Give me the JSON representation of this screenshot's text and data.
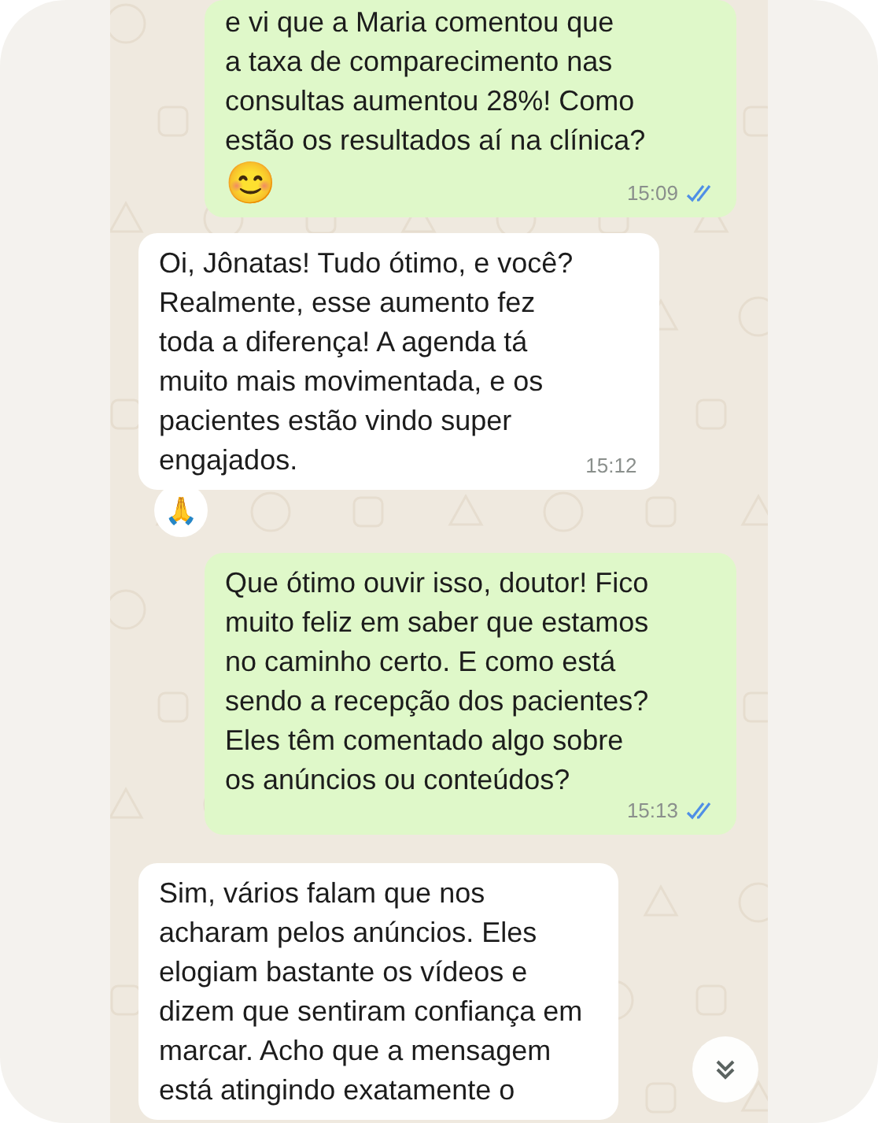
{
  "messages": [
    {
      "kind": "sent",
      "text": "e vi que a Maria comentou que\na taxa de comparecimento nas\nconsultas aumentou 28%! Como\nestão os resultados aí na clínica?",
      "emoji": "😊",
      "time": "15:09",
      "read": true
    },
    {
      "kind": "received",
      "text": "Oi, Jônatas! Tudo ótimo, e você?\nRealmente, esse aumento fez\ntoda a diferença! A agenda tá\nmuito mais movimentada, e os\npacientes estão vindo super\nengajados.",
      "time": "15:12",
      "reaction": "🙏"
    },
    {
      "kind": "sent",
      "text": "Que ótimo ouvir isso, doutor! Fico\nmuito feliz em saber que estamos\nno caminho certo. E como está\nsendo a recepção dos pacientes?\nEles têm comentado algo sobre\nos anúncios ou conteúdos?",
      "time": "15:13",
      "read": true
    },
    {
      "kind": "received",
      "text": "Sim, vários falam que nos\nacharam pelos anúncios. Eles\nelogiam bastante os vídeos e\ndizem que sentiram confiança em\nmarcar. Acho que a mensagem\nestá atingindo exatamente o"
    }
  ]
}
